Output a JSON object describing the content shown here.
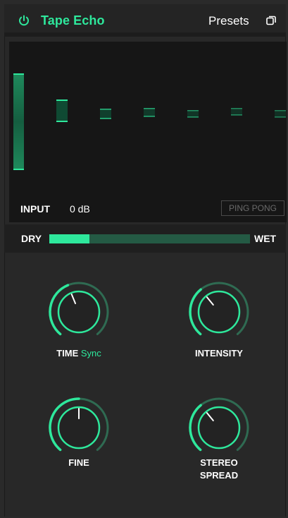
{
  "header": {
    "title": "Tape Echo",
    "presets_label": "Presets",
    "power_icon": "power-icon",
    "copy_icon": "copy-icon",
    "accent_color": "#2ee89c"
  },
  "display": {
    "input_label": "INPUT",
    "input_value": "0 dB",
    "ping_pong_label": "PING PONG"
  },
  "mix": {
    "dry_label": "DRY",
    "wet_label": "WET",
    "value": 0.2
  },
  "knobs": [
    {
      "label": "TIME",
      "sublabel": "Sync",
      "value": 0.42
    },
    {
      "label": "INTENSITY",
      "value": 0.36
    },
    {
      "label": "FINE",
      "value": 0.5
    },
    {
      "label": "STEREO SPREAD",
      "value": 0.36
    }
  ]
}
